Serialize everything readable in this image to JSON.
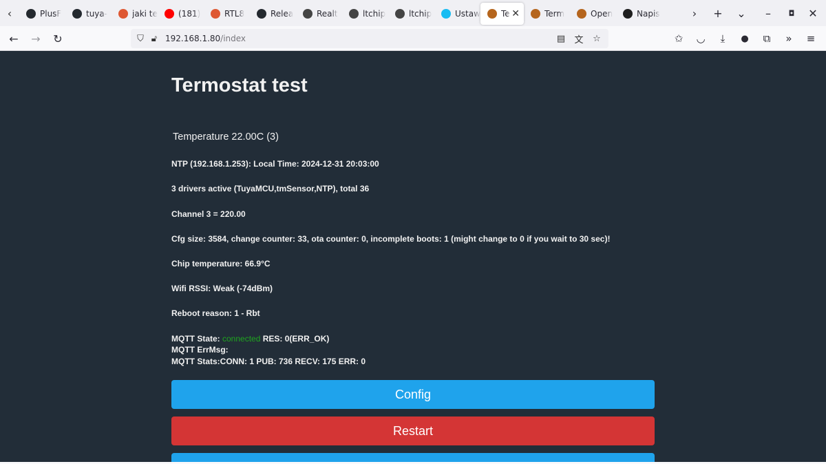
{
  "browser": {
    "tabs": [
      {
        "label": "PlusF",
        "icon": "github-icon",
        "color": "#24292f"
      },
      {
        "label": "tuya-",
        "icon": "github-icon",
        "color": "#24292f"
      },
      {
        "label": "jaki te",
        "icon": "duckduckgo-icon",
        "color": "#de5833"
      },
      {
        "label": "(181)",
        "icon": "youtube-icon",
        "color": "#ff0000"
      },
      {
        "label": "RTL8",
        "icon": "duckduckgo-icon",
        "color": "#de5833"
      },
      {
        "label": "Relea",
        "icon": "github-icon",
        "color": "#24292f"
      },
      {
        "label": "Realt",
        "icon": "site-icon",
        "color": "#444444"
      },
      {
        "label": "ltchip",
        "icon": "site-icon",
        "color": "#444444"
      },
      {
        "label": "ltchip",
        "icon": "site-icon",
        "color": "#444444"
      },
      {
        "label": "Ustaw",
        "icon": "home-assistant-icon",
        "color": "#18bcf2"
      },
      {
        "label": "Te",
        "icon": "openbeken-icon",
        "color": "#b5651d",
        "active": true
      },
      {
        "label": "Term",
        "icon": "openbeken-icon",
        "color": "#b5651d"
      },
      {
        "label": "Open",
        "icon": "openbeken-icon",
        "color": "#b5651d"
      },
      {
        "label": "Napis",
        "icon": "edge-icon",
        "color": "#1e1e1e"
      }
    ],
    "url_host": "192.168.1.80",
    "url_path": "/index"
  },
  "page": {
    "title": "Termostat test",
    "temperature": "Temperature 22.00C (3)",
    "ntp": "NTP (192.168.1.253): Local Time: 2024-12-31 20:03:00",
    "drivers": "3 drivers active (TuyaMCU,tmSensor,NTP), total 36",
    "channel": "Channel 3 = 220.00",
    "cfg": "Cfg size: 3584, change counter: 33, ota counter: 0, incomplete boots: 1 (might change to 0 if you wait to 30 sec)!",
    "chip_temp": "Chip temperature: 66.9°C",
    "wifi": "Wifi RSSI: Weak (-74dBm)",
    "reboot": "Reboot reason: 1 - Rbt",
    "mqtt_state_label": "MQTT State: ",
    "mqtt_state_value": "connected",
    "mqtt_res": " RES: 0(ERR_OK)",
    "mqtt_errmsg": "MQTT ErrMsg:",
    "mqtt_stats": "MQTT Stats:CONN: 1 PUB: 736 RECV: 175 ERR: 0",
    "buttons": {
      "config": "Config",
      "restart": "Restart"
    }
  },
  "colors": {
    "page_bg": "#222d38",
    "button_blue": "#1fa3ec",
    "button_red": "#d43535",
    "connected_green": "#1fa51f"
  }
}
